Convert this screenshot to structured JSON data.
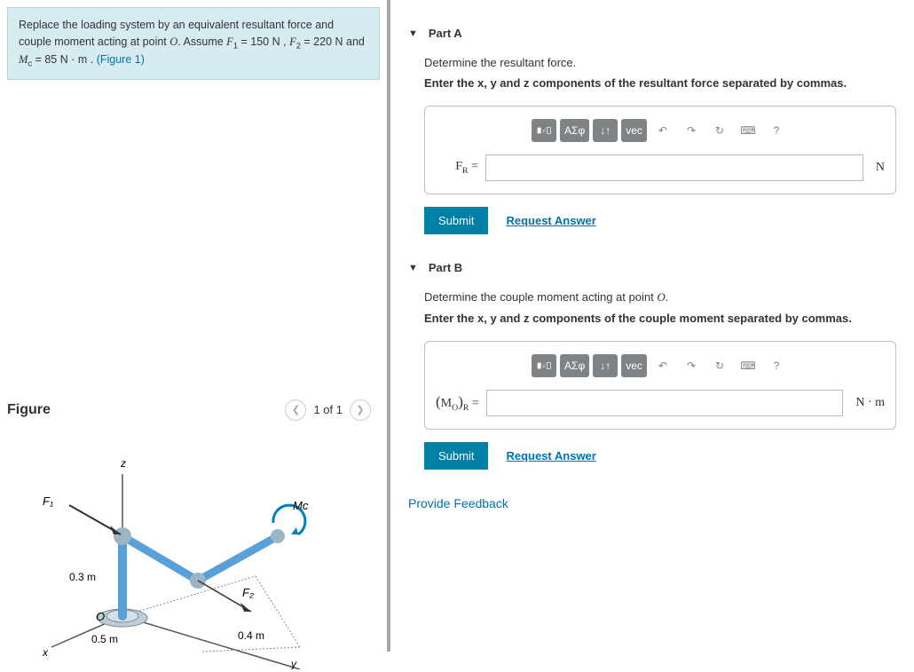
{
  "question": {
    "line1_pre": "Replace the loading system by an equivalent resultant force and couple moment acting at point ",
    "pointO": "O",
    "assume": ". Assume ",
    "F1": "F",
    "F1sub": "1",
    "eq1": " = 150 N , ",
    "F2": "F",
    "F2sub": "2",
    "eq2": " = 220 N and ",
    "Mc": "M",
    "Mcsub": "c",
    "eq3": " = 85 N · m . ",
    "figlink": "(Figure 1)"
  },
  "figure": {
    "title": "Figure",
    "pager": "1 of 1",
    "labels": {
      "z": "z",
      "x": "x",
      "y": "y",
      "F1": "F₁",
      "F2": "F₂",
      "Mc": "Mc",
      "O": "O",
      "d1": "0.3 m",
      "d2": "0.5 m",
      "d3": "0.4 m"
    }
  },
  "partA": {
    "title": "Part A",
    "prompt": "Determine the resultant force.",
    "instruction_pre": "Enter the ",
    "vars": "x, y and z",
    "instruction_post": " components of the resultant force separated by commas.",
    "lhs_base": "F",
    "lhs_sub": "R",
    "unit": "N",
    "submit": "Submit",
    "request": "Request Answer"
  },
  "partB": {
    "title": "Part B",
    "prompt_pre": "Determine the couple moment acting at point ",
    "prompt_O": "O",
    "prompt_post": ".",
    "instruction_pre": "Enter the ",
    "vars": "x, y and z",
    "instruction_post": " components of the couple moment separated by commas.",
    "lhs_html": "(M",
    "lhs_O": "O",
    "lhs_close": ")",
    "lhs_sub": "R",
    "unit": "N · m",
    "submit": "Submit",
    "request": "Request Answer"
  },
  "toolbar": {
    "templates": "■√□",
    "greek": "ΑΣφ",
    "updown": "↓↑",
    "vec": "vec",
    "undo": "↶",
    "redo": "↷",
    "reset": "↻",
    "keyboard": "⌨",
    "help": "?"
  },
  "feedback": "Provide Feedback"
}
